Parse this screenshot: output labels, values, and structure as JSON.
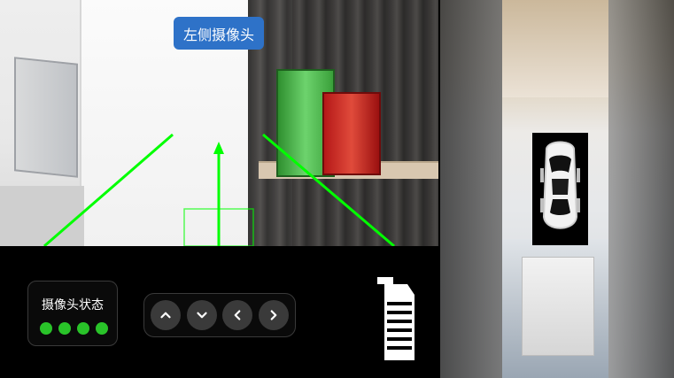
{
  "left_camera": {
    "title": "左侧摄像头"
  },
  "status_panel": {
    "title": "摄像头状态",
    "dot_color": "#29c329",
    "dots": 4
  },
  "navigation": {
    "buttons": [
      {
        "name": "up",
        "icon": "chevron-up-icon"
      },
      {
        "name": "down",
        "icon": "chevron-down-icon"
      },
      {
        "name": "left",
        "icon": "chevron-left-icon"
      },
      {
        "name": "right",
        "icon": "chevron-right-icon"
      }
    ]
  },
  "right_camera": {
    "car_icon": "top-down-car-icon",
    "side_icon": "vehicle-side-indicator-icon"
  },
  "colors": {
    "accent_blue": "#2e72c8",
    "guide_green": "#00ff00",
    "status_green": "#29c329"
  }
}
